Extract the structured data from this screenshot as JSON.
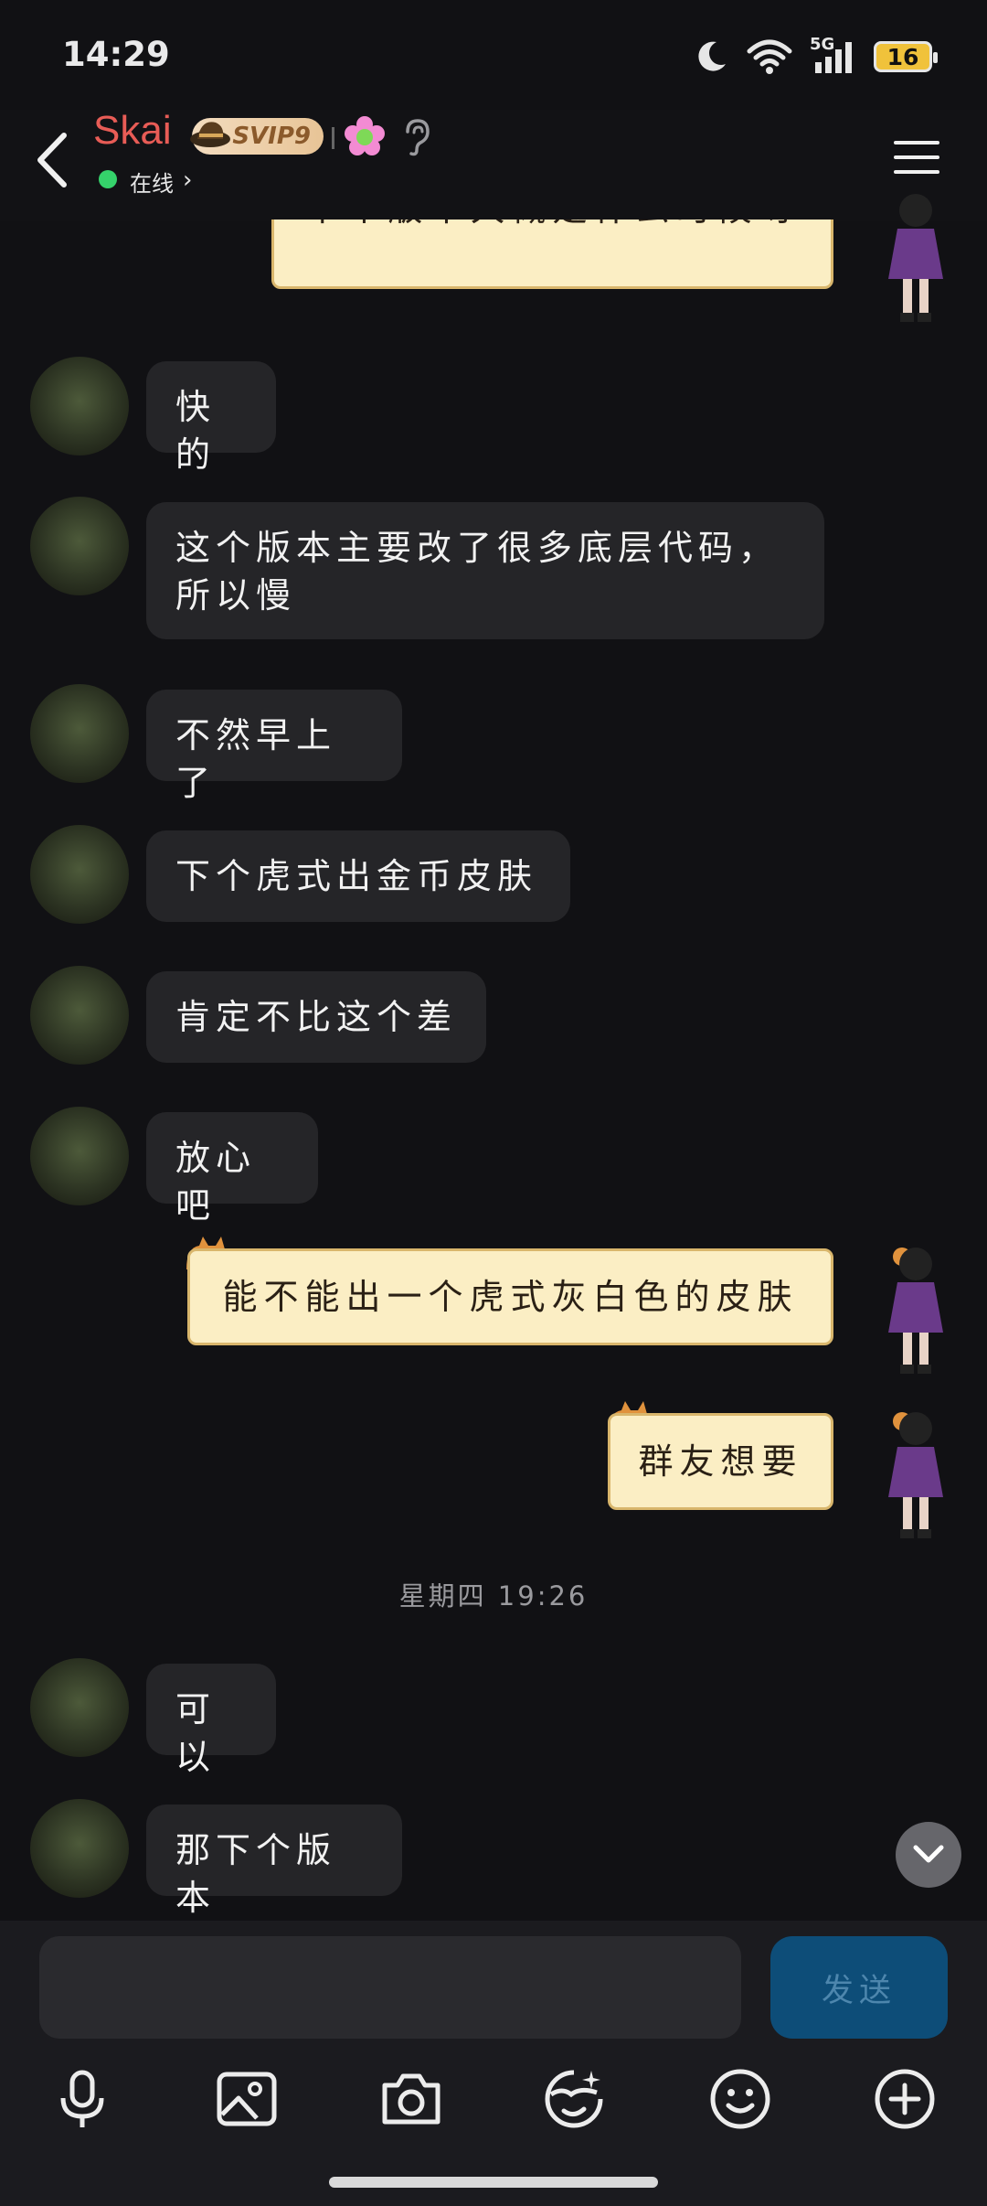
{
  "status_bar": {
    "time": "14:29",
    "network": "5G",
    "battery": "16"
  },
  "header": {
    "contact_name": "Skai",
    "vip_badge": "SVIP9",
    "online_status": "在线",
    "chevron": "›"
  },
  "messages": [
    {
      "side": "me",
      "text": "下个版本大概是什么时候呀"
    },
    {
      "side": "them",
      "text": "快的"
    },
    {
      "side": "them",
      "text": "这个版本主要改了很多底层代码，所以慢"
    },
    {
      "side": "them",
      "text": "不然早上了"
    },
    {
      "side": "them",
      "text": "下个虎式出金币皮肤"
    },
    {
      "side": "them",
      "text": "肯定不比这个差"
    },
    {
      "side": "them",
      "text": "放心吧"
    },
    {
      "side": "me",
      "text": "能不能出一个虎式灰白色的皮肤"
    },
    {
      "side": "me",
      "text": "群友想要"
    },
    {
      "side": "them",
      "text": "可以"
    },
    {
      "side": "them",
      "text": "那下个版本"
    }
  ],
  "timestamp": "星期四 19:26",
  "composer": {
    "input_value": "",
    "send_label": "发送"
  },
  "toolbar": [
    "microphone-icon",
    "image-icon",
    "camera-icon",
    "sticker-icon",
    "emoji-icon",
    "plus-icon"
  ],
  "colors": {
    "background": "#111114",
    "name": "#e85c56",
    "paper_bubble": "#fbeec4",
    "their_bubble": "#252528",
    "send_button": "#0d4d78",
    "online": "#35d26b"
  }
}
